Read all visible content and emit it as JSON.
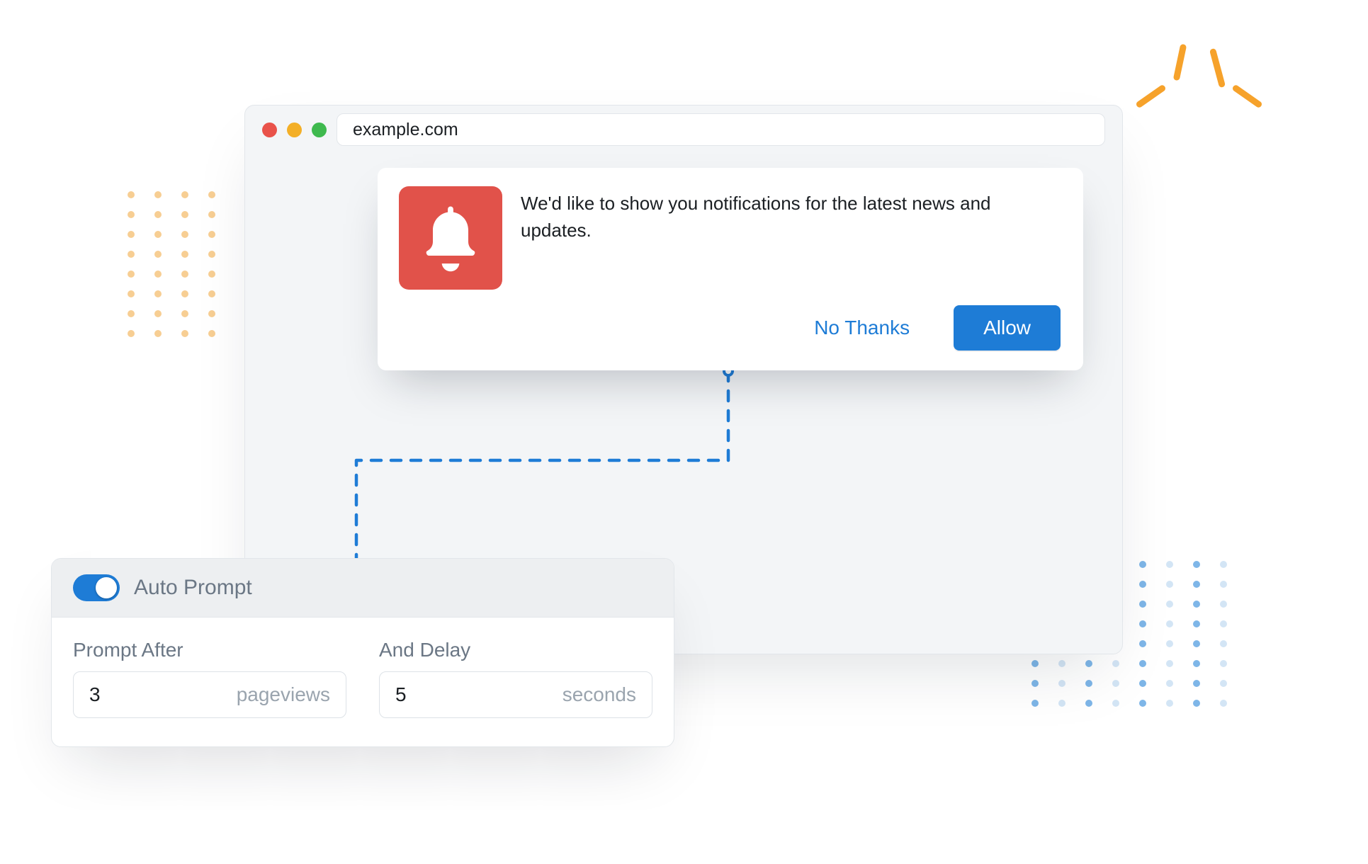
{
  "browser": {
    "url": "example.com"
  },
  "notification": {
    "message": "We'd like to show you notifications for the latest news and updates.",
    "decline_label": "No Thanks",
    "allow_label": "Allow",
    "icon": "bell-icon",
    "icon_bg": "#E1524A"
  },
  "settings": {
    "title": "Auto Prompt",
    "toggle_on": true,
    "fields": {
      "prompt_after": {
        "label": "Prompt After",
        "value": "3",
        "unit": "pageviews"
      },
      "delay": {
        "label": "And Delay",
        "value": "5",
        "unit": "seconds"
      }
    }
  },
  "colors": {
    "accent": "#1E7CD6",
    "peach": "#F7CE93",
    "ray": "#F6A22B"
  }
}
